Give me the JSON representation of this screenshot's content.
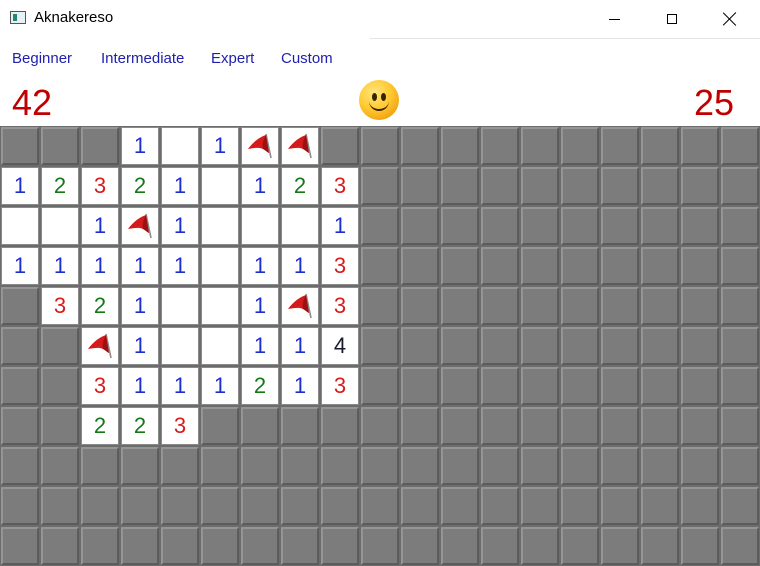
{
  "window": {
    "title": "Aknakereso"
  },
  "menu": [
    "Beginner",
    "Intermediate",
    "Expert",
    "Custom"
  ],
  "counters": {
    "mines_left": "42",
    "timer": "25"
  },
  "colors": {
    "counter": "#c00000",
    "menu": "#2020b0",
    "n1": "#1a2fd0",
    "n2": "#147814",
    "n3": "#d81c1c",
    "n4": "#1a1a2e"
  },
  "board": {
    "cols": 19,
    "rows": 11,
    "grid": [
      "HHH1.1FFHHHHHHHHHHH",
      "12321.123HHHHHHHHHH",
      "..1F1...1HHHHHHHHHH",
      "11111.113HHHHHHHHHH",
      "H321..1F3HHHHHHHHHH",
      "HHF1..114HHHHHHHHHH",
      "HH3111213HHHHHHHHHH",
      "HH223HHHHHHHHHHHHHH",
      "HHHHHHHHHHHHHHHHHHH",
      "HHHHHHHHHHHHHHHHHHH",
      "HHHHHHHHHHHHHHHHHHH"
    ]
  }
}
